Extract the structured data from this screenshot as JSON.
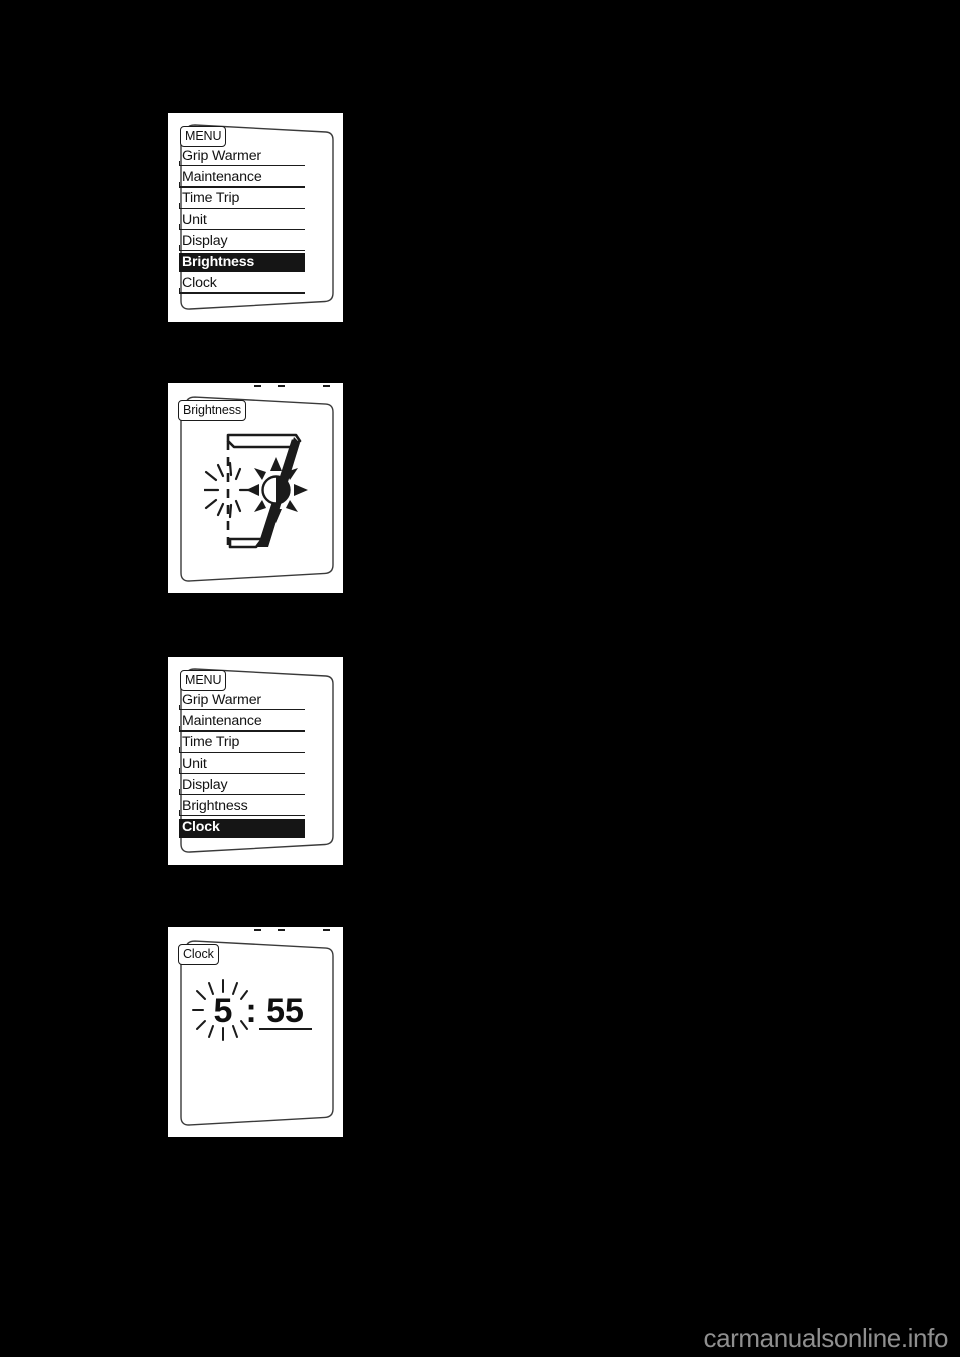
{
  "page": {
    "background_color": "#000000",
    "plate_background_color": "#ffffff",
    "ink_color": "#151515",
    "watermark": "carmanualsonline.info"
  },
  "panels": [
    {
      "id": "menu-brightness-selected",
      "screen_tag": "MENU",
      "type": "menu",
      "items": [
        {
          "label": "Grip Warmer",
          "selected": false
        },
        {
          "label": "Maintenance",
          "selected": false
        },
        {
          "label": "Time Trip",
          "selected": false
        },
        {
          "label": "Unit",
          "selected": false
        },
        {
          "label": "Display",
          "selected": false
        },
        {
          "label": "Brightness",
          "selected": true
        },
        {
          "label": "Clock",
          "selected": false
        }
      ]
    },
    {
      "id": "brightness-setting",
      "screen_tag": "Brightness",
      "type": "brightness",
      "level_digit": "7",
      "icons": [
        "flash-icon",
        "sun-brightness-icon"
      ]
    },
    {
      "id": "menu-clock-selected",
      "screen_tag": "MENU",
      "type": "menu",
      "items": [
        {
          "label": "Grip Warmer",
          "selected": false
        },
        {
          "label": "Maintenance",
          "selected": false
        },
        {
          "label": "Time Trip",
          "selected": false
        },
        {
          "label": "Unit",
          "selected": false
        },
        {
          "label": "Display",
          "selected": false
        },
        {
          "label": "Brightness",
          "selected": false
        },
        {
          "label": "Clock",
          "selected": true
        }
      ]
    },
    {
      "id": "clock-setting",
      "screen_tag": "Clock",
      "type": "clock",
      "hour": "5",
      "separator": ":",
      "minute": "55",
      "blinking_field": "hour",
      "icons": [
        "flash-icon"
      ]
    }
  ]
}
